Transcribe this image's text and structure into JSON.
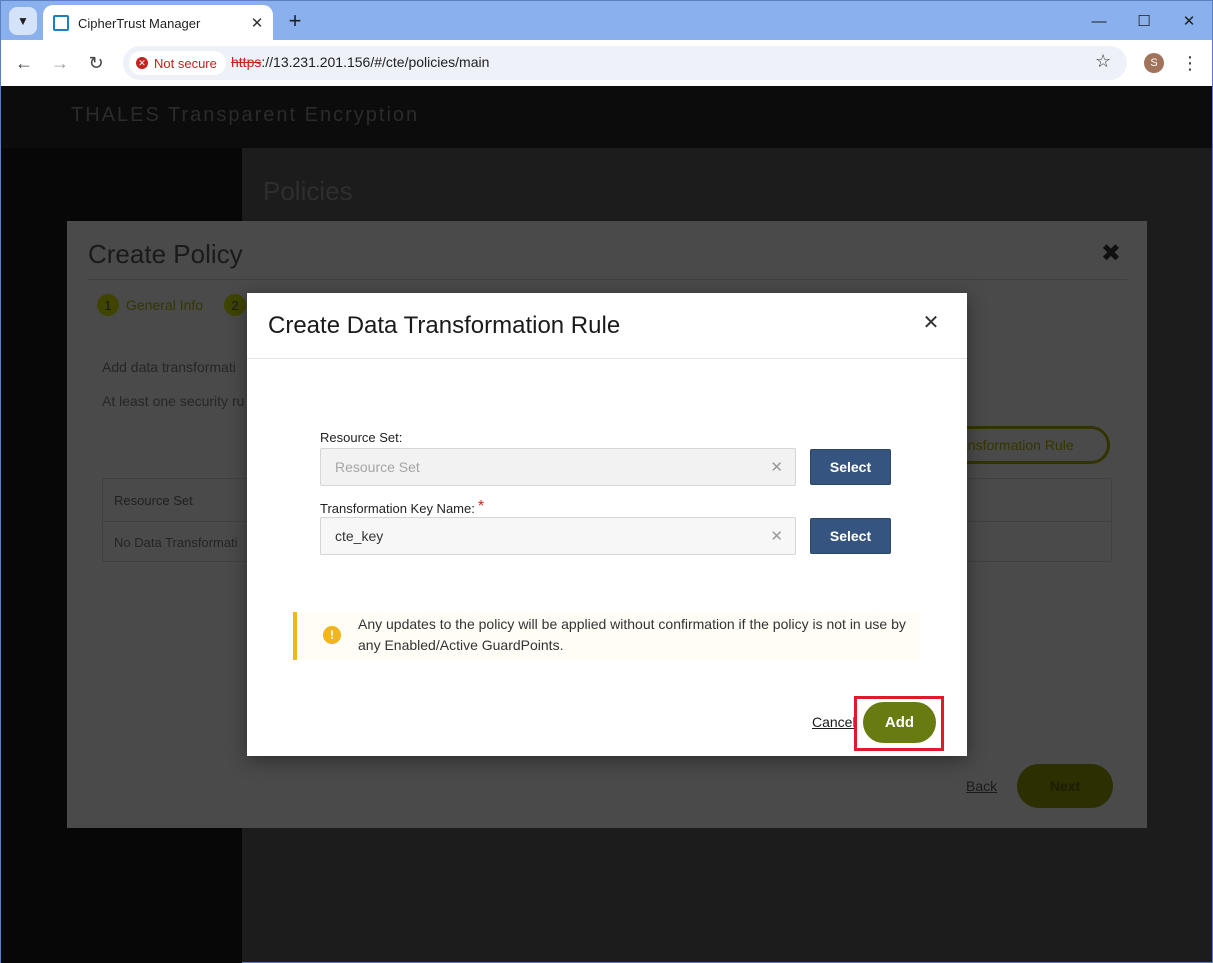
{
  "browser": {
    "tab_title": "CipherTrust Manager",
    "security_label": "Not secure",
    "url_scheme": "https",
    "url_rest": "://13.231.201.156/#/cte/policies/main",
    "profile_initial": "S"
  },
  "app": {
    "brand": "THALES  Transparent Encryption",
    "page_title": "Policies"
  },
  "create_policy": {
    "title": "Create Policy",
    "steps": [
      {
        "num": "1",
        "label": "General Info"
      },
      {
        "num": "2",
        "label": ""
      }
    ],
    "intro_text": "Add data transformati",
    "security_text": "At least one security ru",
    "transformation_rule_button": "ansformation Rule",
    "table": {
      "header_resource_set": "Resource Set",
      "empty_row": "No Data Transformati"
    },
    "back_label": "Back",
    "next_label": "Next"
  },
  "modal": {
    "title": "Create Data Transformation Rule",
    "resource_set": {
      "label": "Resource Set:",
      "placeholder": "Resource Set",
      "select_label": "Select"
    },
    "transformation_key": {
      "label": "Transformation Key Name:",
      "required_mark": "*",
      "value": "cte_key",
      "select_label": "Select"
    },
    "notice": "Any updates to the policy will be applied without confirmation if the policy is not in use by any Enabled/Active GuardPoints.",
    "cancel_label": "Cancel",
    "add_label": "Add",
    "colors": {
      "select_button": "#355580",
      "add_button": "#677b10",
      "notice_accent": "#f2b61c",
      "highlight": "#e0192b"
    }
  }
}
